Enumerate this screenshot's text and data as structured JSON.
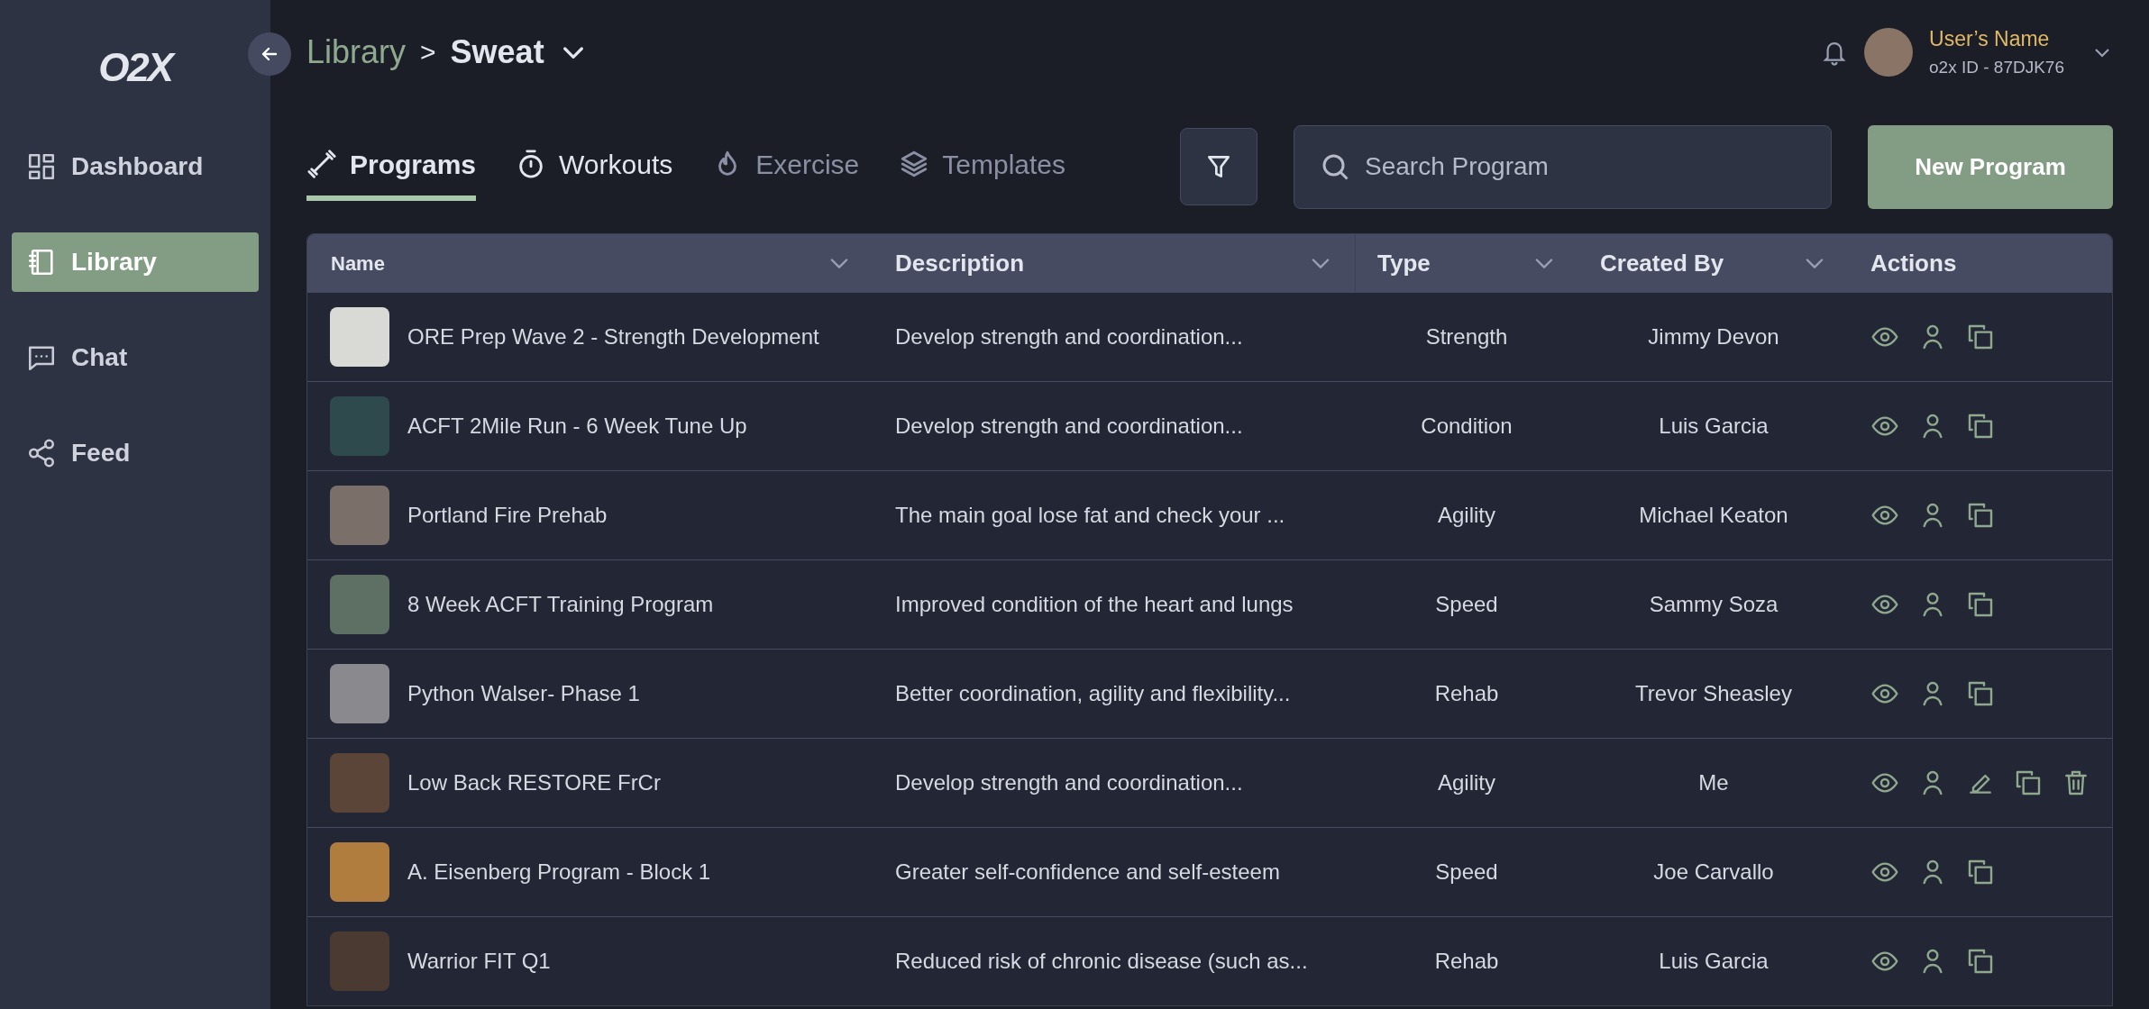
{
  "sidebar": {
    "logo": "O2X",
    "items": [
      {
        "label": "Dashboard",
        "selected": false
      },
      {
        "label": "Library",
        "selected": true
      },
      {
        "label": "Chat",
        "selected": false
      },
      {
        "label": "Feed",
        "selected": false
      }
    ]
  },
  "breadcrumb": {
    "items": [
      "Library",
      "Sweat"
    ],
    "separator": ">"
  },
  "user": {
    "name": "User’s Name",
    "id": "o2x ID - 87DJK76"
  },
  "tabs": [
    {
      "label": "Programs",
      "selected": true,
      "disabled": false
    },
    {
      "label": "Workouts",
      "selected": false,
      "disabled": false
    },
    {
      "label": "Exercise",
      "selected": false,
      "disabled": true
    },
    {
      "label": "Templates",
      "selected": false,
      "disabled": true
    }
  ],
  "search": {
    "placeholder": "Search Program"
  },
  "new_button": "New Program",
  "table": {
    "columns": [
      {
        "label": "Name",
        "sortable": true
      },
      {
        "label": "Description",
        "sortable": true
      },
      {
        "label": "Type",
        "sortable": true
      },
      {
        "label": "Created By",
        "sortable": true
      },
      {
        "label": "Actions",
        "sortable": false
      }
    ],
    "rows": [
      {
        "name": "ORE Prep Wave 2 - Strength Development",
        "description": "Develop strength and coordination...",
        "type": "Strength",
        "created_by": "Jimmy Devon",
        "actions": [
          {
            "kind": "view"
          },
          {
            "kind": "assign"
          },
          {
            "kind": "copy"
          }
        ]
      },
      {
        "name": "ACFT 2Mile Run - 6 Week Tune Up",
        "description": "Develop strength and coordination...",
        "type": "Condition",
        "created_by": "Luis Garcia",
        "actions": [
          {
            "kind": "view"
          },
          {
            "kind": "assign"
          },
          {
            "kind": "copy"
          }
        ]
      },
      {
        "name": "Portland Fire Prehab",
        "description": "The main goal lose fat and check your ...",
        "type": "Agility",
        "created_by": "Michael Keaton",
        "actions": [
          {
            "kind": "view"
          },
          {
            "kind": "assign"
          },
          {
            "kind": "copy"
          }
        ]
      },
      {
        "name": "8 Week ACFT Training Program",
        "description": "Improved condition of the heart and lungs",
        "type": "Speed",
        "created_by": "Sammy Soza",
        "actions": [
          {
            "kind": "view"
          },
          {
            "kind": "assign"
          },
          {
            "kind": "copy"
          }
        ]
      },
      {
        "name": "Python Walser- Phase 1",
        "description": "Better coordination, agility and flexibility...",
        "type": "Rehab",
        "created_by": "Trevor Sheasley",
        "actions": [
          {
            "kind": "view"
          },
          {
            "kind": "assign"
          },
          {
            "kind": "copy"
          }
        ]
      },
      {
        "name": "Low Back RESTORE FrCr",
        "description": "Develop strength and coordination...",
        "type": "Agility",
        "created_by": "Me",
        "actions": [
          {
            "kind": "view"
          },
          {
            "kind": "assign"
          },
          {
            "kind": "edit"
          },
          {
            "kind": "copy"
          },
          {
            "kind": "delete"
          }
        ]
      },
      {
        "name": "A. Eisenberg Program - Block 1",
        "description": "Greater self-confidence and self-esteem",
        "type": "Speed",
        "created_by": "Joe Carvallo",
        "actions": [
          {
            "kind": "view"
          },
          {
            "kind": "assign"
          },
          {
            "kind": "copy"
          }
        ]
      },
      {
        "name": "Warrior FIT Q1",
        "description": "Reduced risk of chronic disease (such as...",
        "type": "Rehab",
        "created_by": "Luis Garcia",
        "actions": [
          {
            "kind": "view"
          },
          {
            "kind": "assign"
          },
          {
            "kind": "copy"
          }
        ]
      }
    ]
  }
}
